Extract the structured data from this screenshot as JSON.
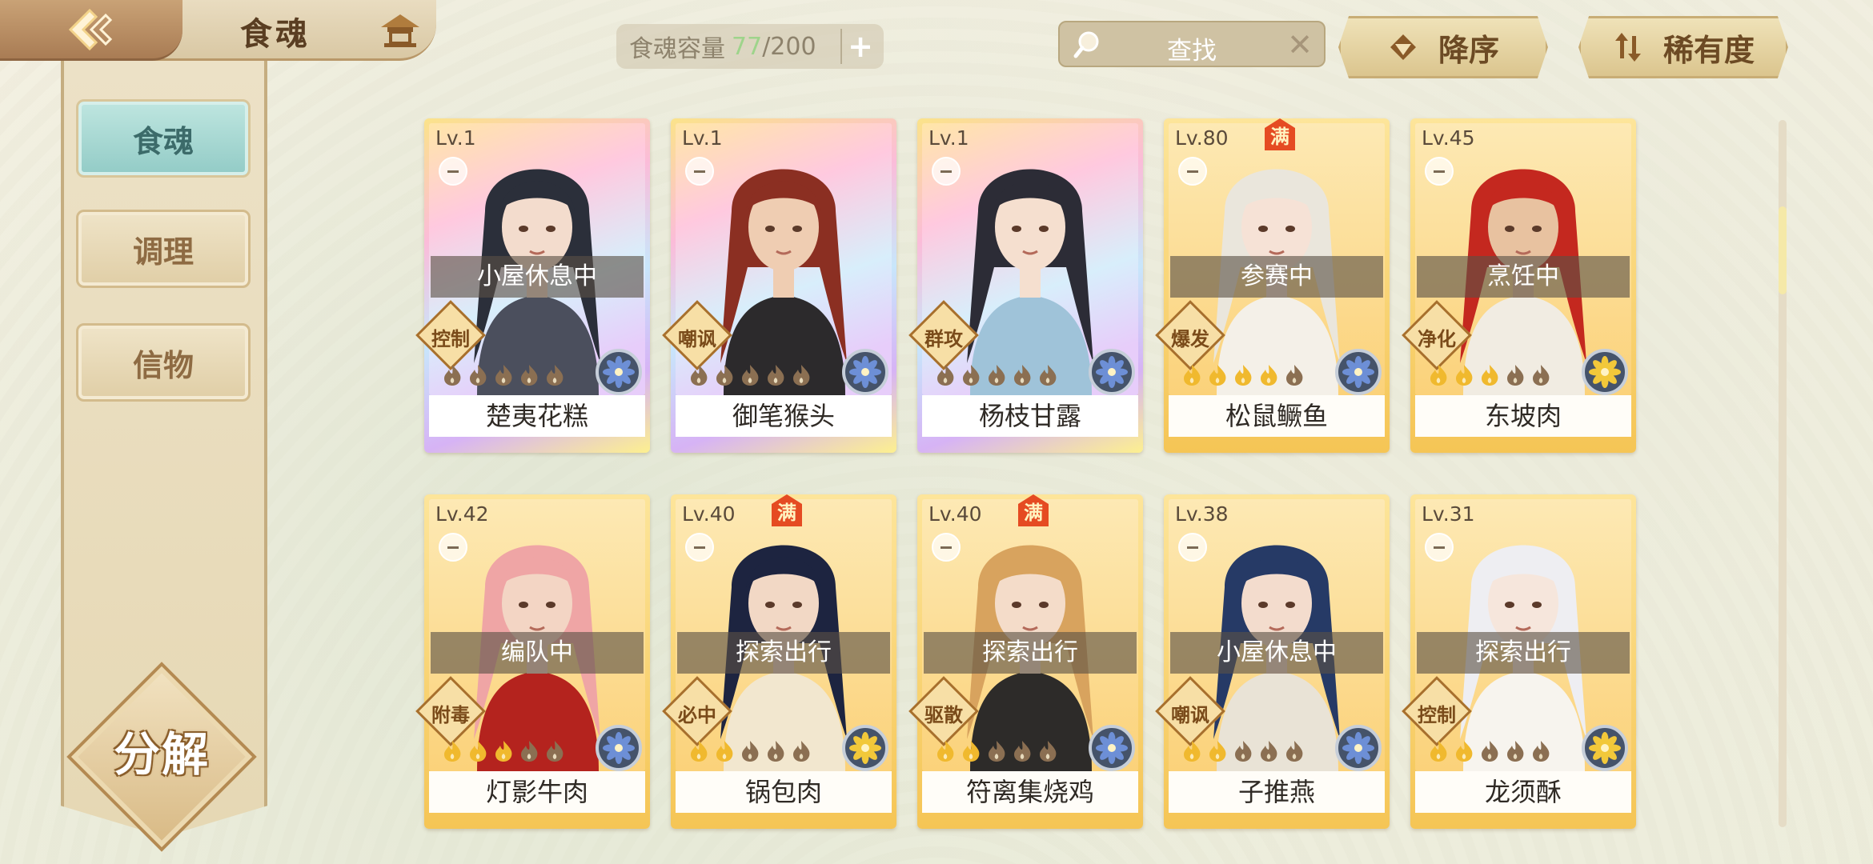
{
  "header": {
    "title": "食魂",
    "capacity_label": "食魂容量",
    "capacity_current": "77",
    "capacity_sep_max": "/200",
    "capacity_add": "+",
    "search_placeholder": "查找",
    "search_clear": "✕",
    "sort_order_label": "降序",
    "sort_key_label": "稀有度"
  },
  "sidebar": {
    "items": [
      {
        "label": "食魂",
        "active": true
      },
      {
        "label": "调理",
        "active": false
      },
      {
        "label": "信物",
        "active": false
      }
    ],
    "decompose_label": "分解"
  },
  "icons": {
    "back": "back-arrow-icon",
    "home": "pavilion-icon",
    "search": "magnifier-icon",
    "sort_order": "triangle-down-icon",
    "sort_key": "swap-icon",
    "star": "flame-star-icon",
    "element_blue": "blue-flower-icon",
    "element_gold": "gold-flower-icon"
  },
  "colors": {
    "rainbow_frame": "#fbbcd9",
    "gold_frame": "#f5c555",
    "full_badge": "#e54b22",
    "active_tab": "#92cbc6",
    "capacity_current": "#9ed48b"
  },
  "cards": [
    {
      "name": "楚夷花糕",
      "level": "Lv.1",
      "status": "小屋休息中",
      "role": "控制",
      "stars": 5,
      "lit_stars": 0,
      "frame": "rainbow",
      "full": false,
      "element": "blue",
      "hair": "#2b2f3a",
      "skin": "#f3dccd",
      "cloth": "#4b4f5d"
    },
    {
      "name": "御笔猴头",
      "level": "Lv.1",
      "status": "",
      "role": "嘲讽",
      "stars": 5,
      "lit_stars": 0,
      "frame": "rainbow",
      "full": false,
      "element": "blue",
      "hair": "#8b2f22",
      "skin": "#efcdb2",
      "cloth": "#2c2a2c"
    },
    {
      "name": "杨枝甘露",
      "level": "Lv.1",
      "status": "",
      "role": "群攻",
      "stars": 5,
      "lit_stars": 0,
      "frame": "rainbow",
      "full": false,
      "element": "blue",
      "hair": "#2c2c36",
      "skin": "#f5dfcf",
      "cloth": "#9fc3d9"
    },
    {
      "name": "松鼠鳜鱼",
      "level": "Lv.80",
      "status": "参赛中",
      "role": "爆发",
      "stars": 5,
      "lit_stars": 4,
      "frame": "gold",
      "full": true,
      "element": "blue",
      "hair": "#eae6dc",
      "skin": "#f6e2d6",
      "cloth": "#f4f0e8"
    },
    {
      "name": "东坡肉",
      "level": "Lv.45",
      "status": "烹饪中",
      "role": "净化",
      "stars": 5,
      "lit_stars": 3,
      "frame": "gold",
      "full": false,
      "element": "gold",
      "hair": "#c4281f",
      "skin": "#e8c2a0",
      "cloth": "#f1ece2"
    },
    {
      "name": "灯影牛肉",
      "level": "Lv.42",
      "status": "编队中",
      "role": "附毒",
      "stars": 5,
      "lit_stars": 3,
      "frame": "gold",
      "full": false,
      "element": "blue",
      "hair": "#efa5a5",
      "skin": "#f3d5c4",
      "cloth": "#b4231e"
    },
    {
      "name": "锅包肉",
      "level": "Lv.40",
      "status": "探索出行",
      "role": "必中",
      "stars": 5,
      "lit_stars": 2,
      "frame": "gold",
      "full": true,
      "element": "gold",
      "hair": "#1d2440",
      "skin": "#f2d8c5",
      "cloth": "#f2e7cf"
    },
    {
      "name": "符离集烧鸡",
      "level": "Lv.40",
      "status": "探索出行",
      "role": "驱散",
      "stars": 5,
      "lit_stars": 2,
      "frame": "gold",
      "full": true,
      "element": "blue",
      "hair": "#d8a35e",
      "skin": "#f4dcc9",
      "cloth": "#2d2b29"
    },
    {
      "name": "子推燕",
      "level": "Lv.38",
      "status": "小屋休息中",
      "role": "嘲讽",
      "stars": 5,
      "lit_stars": 2,
      "frame": "gold",
      "full": false,
      "element": "blue",
      "hair": "#263a66",
      "skin": "#f3dccd",
      "cloth": "#e9e3d6"
    },
    {
      "name": "龙须酥",
      "level": "Lv.31",
      "status": "探索出行",
      "role": "控制",
      "stars": 5,
      "lit_stars": 2,
      "frame": "gold",
      "full": false,
      "element": "gold",
      "hair": "#eeeef2",
      "skin": "#f6e6dc",
      "cloth": "#f7f4ee"
    }
  ]
}
